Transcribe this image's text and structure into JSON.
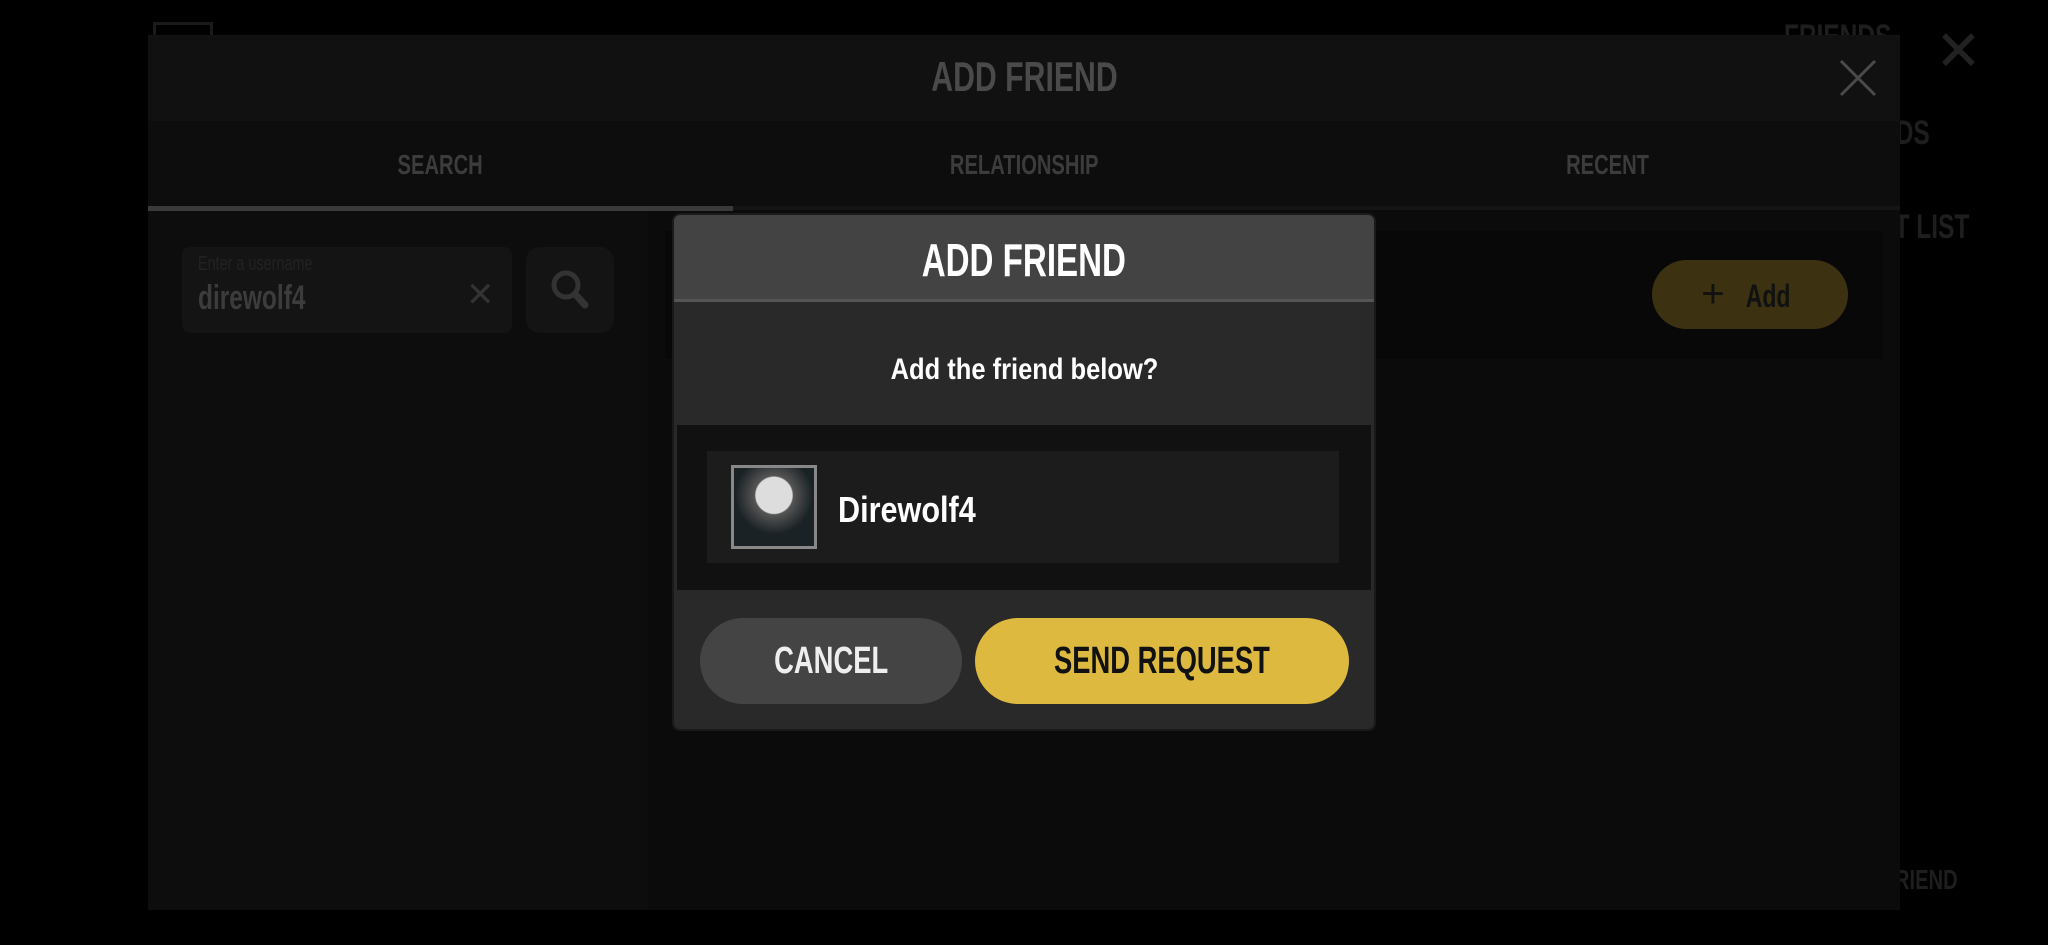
{
  "background": {
    "title": "FRIENDS",
    "item_1": "NDS",
    "item_2": "T LIST",
    "item_3": "FRIEND"
  },
  "panel": {
    "title": "ADD FRIEND",
    "tabs": [
      {
        "label": "SEARCH",
        "active": true
      },
      {
        "label": "RELATIONSHIP"
      },
      {
        "label": "RECENT"
      }
    ],
    "search": {
      "placeholder": "Enter a username",
      "value": "direwolf4"
    },
    "result": {
      "add_label": "Add"
    }
  },
  "dialog": {
    "title": "ADD FRIEND",
    "question": "Add the friend below?",
    "username": "Direwolf4",
    "cancel_label": "CANCEL",
    "send_label": "SEND REQUEST"
  },
  "colors": {
    "accent": "#ddb93f",
    "dialog_bg": "#292929",
    "header_bg": "#434343"
  }
}
